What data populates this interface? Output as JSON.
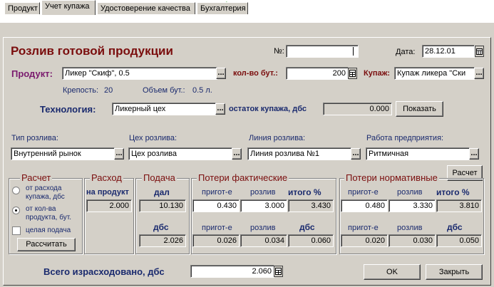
{
  "tabs": [
    "Продукт",
    "Учет купажа",
    "Удостоверение качества",
    "Бухгалтерия"
  ],
  "title": "Розлив готовой продукции",
  "number": {
    "label": "№:",
    "value": ""
  },
  "date": {
    "label": "Дата:",
    "value": "28.12.01"
  },
  "product": {
    "label": "Продукт:",
    "value": "Ликер \"Скиф\", 0.5"
  },
  "bottles": {
    "label": "кол-во бут.:",
    "value": "200"
  },
  "kupazh": {
    "label": "Купаж:",
    "value": "Купаж ликера \"Ски"
  },
  "strength": {
    "label": "Крепость:",
    "value": "20"
  },
  "volume": {
    "label": "Объем бут.:",
    "value": "0.5 л."
  },
  "technology": {
    "label": "Технология:",
    "value": "Ликерный цех"
  },
  "remainder": {
    "label": "остаток купажа, дбс",
    "value": "0.000"
  },
  "show_button": "Показать",
  "bottling_type": {
    "label": "Тип розлива:",
    "value": "Внутренний рынок"
  },
  "bottling_shop": {
    "label": "Цех розлива:",
    "value": "Цех розлива"
  },
  "bottling_line": {
    "label": "Линия розлива:",
    "value": "Линия розлива №1"
  },
  "enterprise_work": {
    "label": "Работа предприятия:",
    "value": "Ритмичная"
  },
  "calc_button": "Расчет",
  "calc_group": {
    "title": "Расчет",
    "option1": "от расхода купажа, дбс",
    "option2": "от кол-ва продукта, бут.",
    "checkbox": "целая подача",
    "button": "Рассчитать"
  },
  "expense": {
    "title": "Расход",
    "header": "на продукт",
    "value": "2.000"
  },
  "supply": {
    "title": "Подача",
    "header1": "дал",
    "value1": "10.130",
    "header2": "дбс",
    "value2": "2.026"
  },
  "losses_actual": {
    "title": "Потери фактические",
    "col1": "пригот-е",
    "col2": "розлив",
    "col3": "итого %",
    "row1": [
      "0.430",
      "3.000",
      "3.430"
    ],
    "col1b": "пригот-е",
    "col2b": "розлив",
    "col3b": "дбс",
    "row2": [
      "0.026",
      "0.034",
      "0.060"
    ]
  },
  "losses_norm": {
    "title": "Потери нормативные",
    "col1": "пригот-е",
    "col2": "розлив",
    "col3": "итого %",
    "row1": [
      "0.480",
      "3.330",
      "3.810"
    ],
    "col1b": "пригот-е",
    "col2b": "розлив",
    "col3b": "дбс",
    "row2": [
      "0.020",
      "0.030",
      "0.050"
    ]
  },
  "total": {
    "label": "Всего израсходовано, дбс",
    "value": "2.060"
  },
  "ok_button": "OK",
  "close_button": "Закрыть",
  "colors": {
    "title": "#7a0d0d",
    "product_label": "#7a1a6e",
    "navy": "#1a2a6e",
    "face": "#d4d0c8"
  }
}
